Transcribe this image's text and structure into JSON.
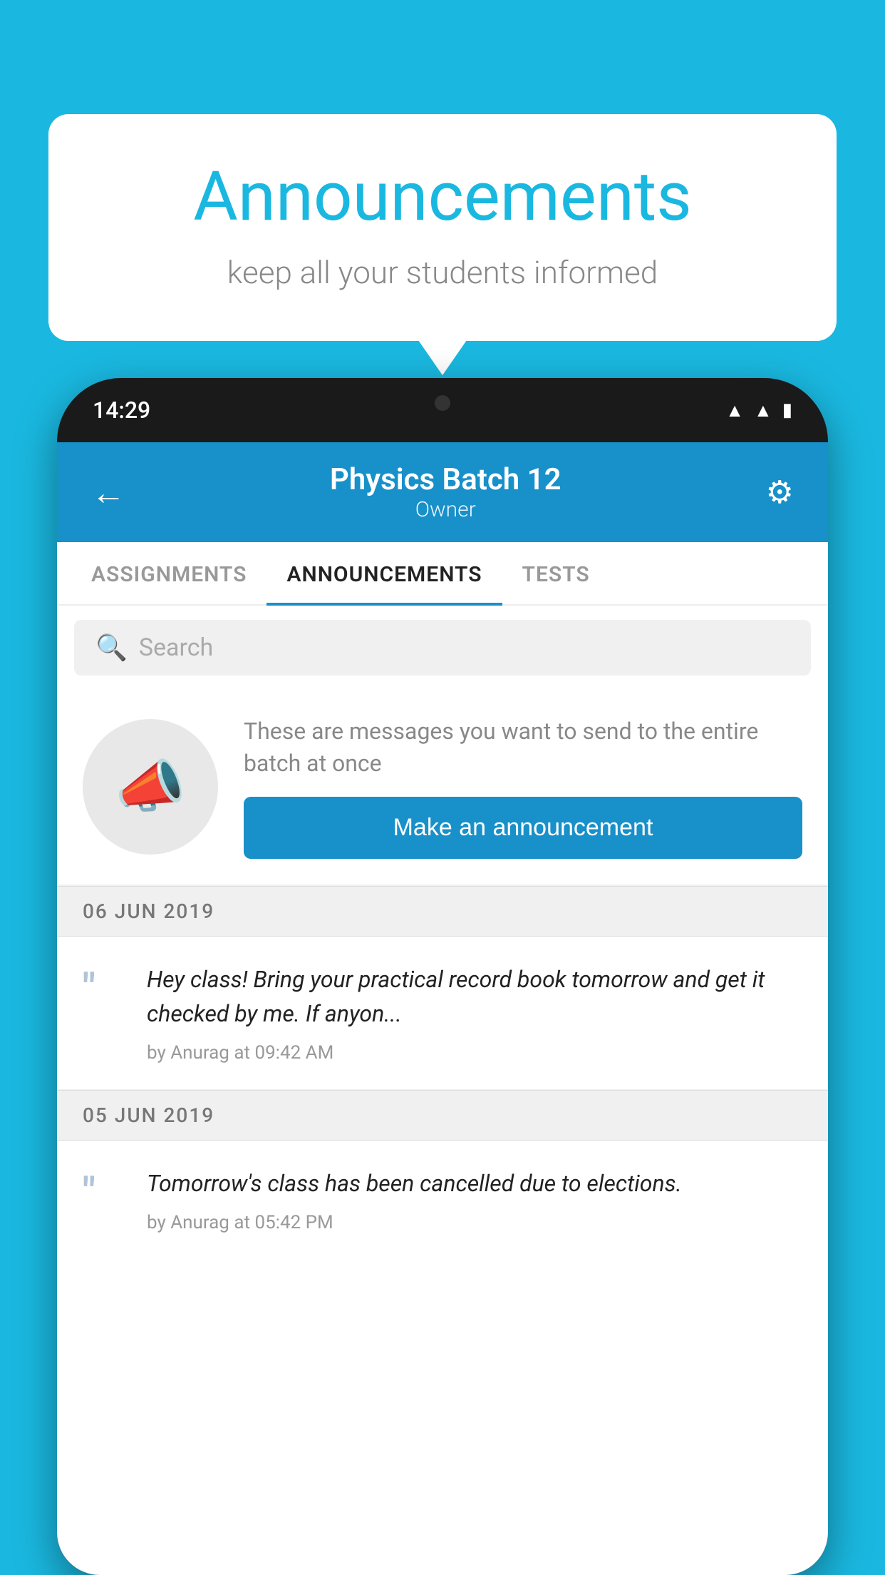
{
  "background_color": "#1ab8e0",
  "speech_bubble": {
    "title": "Announcements",
    "subtitle": "keep all your students informed"
  },
  "status_bar": {
    "time": "14:29",
    "wifi_icon": "▲",
    "signal_icon": "▲",
    "battery_icon": "▮"
  },
  "header": {
    "back_label": "←",
    "title": "Physics Batch 12",
    "subtitle": "Owner",
    "settings_icon": "⚙"
  },
  "tabs": [
    {
      "label": "ASSIGNMENTS",
      "active": false
    },
    {
      "label": "ANNOUNCEMENTS",
      "active": true
    },
    {
      "label": "TESTS",
      "active": false
    }
  ],
  "search": {
    "placeholder": "Search",
    "icon": "🔍"
  },
  "announcement_prompt": {
    "description": "These are messages you want to send to the entire batch at once",
    "button_label": "Make an announcement"
  },
  "announcements": [
    {
      "date": "06  JUN  2019",
      "text": "Hey class! Bring your practical record book tomorrow and get it checked by me. If anyon...",
      "meta": "by Anurag at 09:42 AM"
    },
    {
      "date": "05  JUN  2019",
      "text": "Tomorrow's class has been cancelled due to elections.",
      "meta": "by Anurag at 05:42 PM"
    }
  ]
}
